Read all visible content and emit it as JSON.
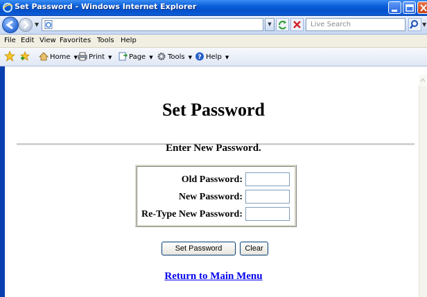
{
  "window": {
    "title": "Set Password - Windows Internet Explorer"
  },
  "toolbar": {
    "address_value": "",
    "search_placeholder": "Live Search"
  },
  "menu": [
    "File",
    "Edit",
    "View",
    "Favorites",
    "Tools",
    "Help"
  ],
  "command_bar": {
    "home_label": "Home",
    "print_label": "Print",
    "page_label": "Page",
    "tools_label": "Tools",
    "help_label": "Help"
  },
  "page": {
    "title": "Set Password",
    "instruction": "Enter New Password.",
    "fields": [
      {
        "label": "Old Password:",
        "value": ""
      },
      {
        "label": "New Password:",
        "value": ""
      },
      {
        "label": "Re-Type New Password:",
        "value": ""
      }
    ],
    "submit_label": "Set Password",
    "clear_label": "Clear",
    "return_link": "Return to Main Menu"
  },
  "colors": {
    "titlebar": "#0a5fd8",
    "link": "#0000ee",
    "menubar": "#f1efe2"
  },
  "icons": [
    "ie-icon",
    "minimize-icon",
    "maximize-icon",
    "close-icon",
    "back-icon",
    "forward-icon",
    "page-icon",
    "refresh-icon",
    "stop-icon",
    "search-icon",
    "favorites-star-icon",
    "add-favorites-icon",
    "home-icon",
    "print-icon",
    "page-menu-icon",
    "tools-gear-icon",
    "help-icon"
  ]
}
